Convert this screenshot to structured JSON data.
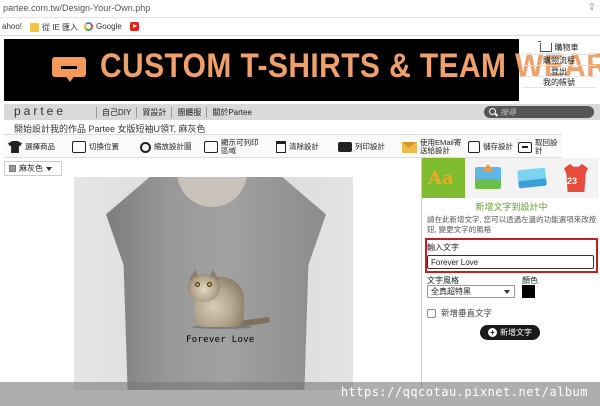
{
  "browser": {
    "url": "partee.com.tw/Design-Your-Own.php"
  },
  "bookmarks": [
    {
      "label": "ahoo!",
      "icon": "none"
    },
    {
      "label": "從 IE 匯入",
      "icon": "folder-icon"
    },
    {
      "label": "Google",
      "icon": "google-icon"
    },
    {
      "label": "",
      "icon": "youtube-icon"
    }
  ],
  "banner": {
    "title": "CUSTOM T-SHIRTS & TEAM WEAR",
    "accent_color": "#f0a06a"
  },
  "account_menu": {
    "cart": "購物車",
    "process": "購物流程",
    "logout": "登出",
    "account": "我的帳號"
  },
  "nav": {
    "brand": "partee",
    "links": [
      "自己DIY",
      "買設計",
      "團體服",
      "關於Partee"
    ],
    "search_placeholder": "搜尋"
  },
  "product_title": "開始設計我的作品 Partee 女版短袖U領T, 麻灰色",
  "toolbar": {
    "items": [
      {
        "label": "選擇商品",
        "icon": "shirt-icon"
      },
      {
        "label": "切換位置",
        "icon": "shirt-outline-icon"
      },
      {
        "label": "縮放設計圖",
        "icon": "magnifier-icon"
      },
      {
        "label": "顯示可列印區域",
        "icon": "shirt-outline-icon"
      },
      {
        "label": "清除設計",
        "icon": "trash-icon"
      },
      {
        "label": "列印設計",
        "icon": "printer-icon"
      },
      {
        "label": "使用EMail寄送給設計",
        "icon": "mail-icon"
      },
      {
        "label": "儲存設計",
        "icon": "save-icon"
      },
      {
        "label": "取回設計",
        "icon": "retrieve-icon"
      }
    ]
  },
  "color_select": {
    "value": "麻灰色",
    "swatch": "#9a9a9a"
  },
  "design": {
    "text": "Forever Love"
  },
  "panel": {
    "tabs": [
      "text-tab",
      "upload-tab",
      "gallery-tab",
      "jersey-tab"
    ],
    "tab_text_glyph": "Aa",
    "jersey_number": "23",
    "title": "新增文字到設計中",
    "description": "請在此新增文字, 您可以透過左邊的功能選項來改按鈕, 變更文字的風格",
    "input_label": "輸入文字",
    "input_value": "Forever Love",
    "style_label": "文字風格",
    "style_value": "全真超特黑",
    "color_label": "顏色",
    "text_color": "#000000",
    "vertical_label": "新增垂直文字",
    "add_button": "新增文字",
    "highlight_color": "#c0211f"
  },
  "watermark": "https://qqcotau.pixnet.net/album"
}
